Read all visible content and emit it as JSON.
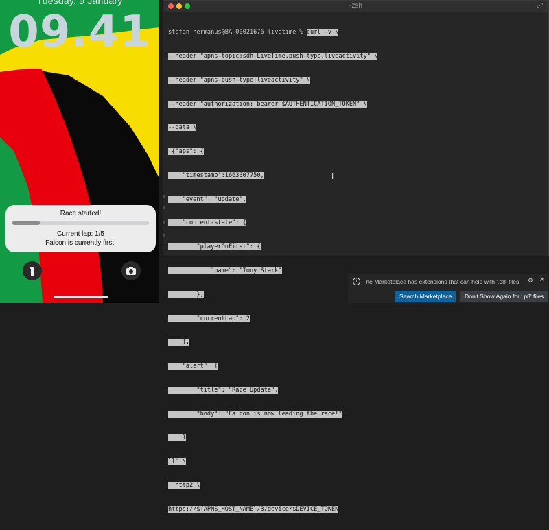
{
  "lock_screen": {
    "date": "Tuesday, 9 January",
    "time": "09.41",
    "live_activity": {
      "title": "Race started!",
      "progress": 0.2,
      "lap": "Current lap: 1/5",
      "leader": "Falcon is currently first!"
    },
    "icons": {
      "left": "flashlight-icon",
      "right": "camera-icon"
    }
  },
  "terminal": {
    "title": "-zsh",
    "prompt": "stefan.hermanus@BA-00021676 livetime % ",
    "lines": [
      "curl -v \\",
      "--header \"apns-topic:sdh.LiveTime.push-type.liveactivity\" \\",
      "--header \"apns-push-type:liveactivity\" \\",
      "--header \"authorization: bearer $AUTHENTICATION_TOKEN\" \\",
      "--data \\",
      "'{\"aps\": {",
      "    \"timestamp\":1663307750,",
      "    \"event\": \"update\",",
      "    \"content-state\": {",
      "        \"playerOnFirst\": {",
      "            \"name\": \"Tony Stark\"",
      "        },",
      "        \"currentLap\": 2",
      "    },",
      "    \"alert\": {",
      "        \"title\": \"Race Update\",",
      "        \"body\": \"Falcon is now leading the race!\"",
      "    }",
      "}}' \\",
      "--http2 \\",
      "https://${APNS_HOST_NAME}/3/device/$DEVICE_TOKEN"
    ]
  },
  "notification": {
    "icon": "info-icon",
    "message": "The Marketplace has extensions that can help with '.p8' files",
    "primary_button": "Search Marketplace",
    "secondary_button": "Don't Show Again for '.p8' files"
  },
  "colors": {
    "wall_green": "#129a45",
    "wall_yellow": "#f8dd00",
    "wall_red": "#e8000c",
    "terminal_bg": "#262626",
    "selection": "#c4c4c4",
    "vscode_button": "#0e639c"
  }
}
